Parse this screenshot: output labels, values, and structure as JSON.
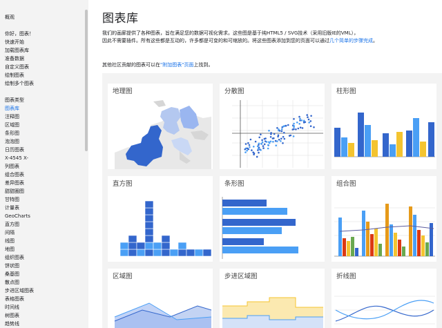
{
  "sidebar": {
    "items": [
      {
        "label": "概观",
        "active": false
      },
      {
        "label": "你好，图表！",
        "active": false
      },
      {
        "label": "快速开始",
        "active": false
      },
      {
        "label": "加载图表库",
        "active": false
      },
      {
        "label": "准备数据",
        "active": false
      },
      {
        "label": "自定义图表",
        "active": false
      },
      {
        "label": "绘制图表",
        "active": false
      },
      {
        "label": "绘制多个图表",
        "active": false
      },
      {
        "label": "图表类型",
        "active": false
      },
      {
        "label": "图表库",
        "active": true
      },
      {
        "label": "注释图",
        "active": false
      },
      {
        "label": "区域图",
        "active": false
      },
      {
        "label": "条形图",
        "active": false
      },
      {
        "label": "泡泡图",
        "active": false
      },
      {
        "label": "日历图表",
        "active": false
      },
      {
        "label": "X-4545 X-",
        "active": false
      },
      {
        "label": "列图表",
        "active": false
      },
      {
        "label": "组合图表",
        "active": false
      },
      {
        "label": "差异图表",
        "active": false
      },
      {
        "label": "甜甜圈图",
        "active": false
      },
      {
        "label": "甘特图",
        "active": false
      },
      {
        "label": "计量表",
        "active": false
      },
      {
        "label": "GeoCharts",
        "active": false
      },
      {
        "label": "直方图",
        "active": false
      },
      {
        "label": "间隔",
        "active": false
      },
      {
        "label": "线图",
        "active": false
      },
      {
        "label": "地图",
        "active": false
      },
      {
        "label": "组织图表",
        "active": false
      },
      {
        "label": "饼状图",
        "active": false
      },
      {
        "label": "桑基图",
        "active": false
      },
      {
        "label": "散点图",
        "active": false
      },
      {
        "label": "步进区域图表",
        "active": false
      },
      {
        "label": "表格图表",
        "active": false
      },
      {
        "label": "时间线",
        "active": false
      },
      {
        "label": "树图表",
        "active": false
      },
      {
        "label": "趋势线",
        "active": false
      }
    ]
  },
  "main": {
    "title": "图表库",
    "para1_line1": "我们的画廊提供了各种图表，旨在满足您的数据可视化需求。这些图是基于纯HTML5 / SVG技术（采用旧版IE的VML），",
    "para1_line2a": "因此不需要插件。所有这些都是互动的，许多都是可变的和可缩放的。将这些图表添加到您的页面可以通过",
    "para1_link": "几个简单的步骤完成",
    "para1_end": "。",
    "para2_before": "其他社区贡献的图表可以在",
    "para2_link": "\"附加图表\"页面",
    "para2_after": "上找到。"
  },
  "cards": [
    {
      "title": "地理图"
    },
    {
      "title": "分散图"
    },
    {
      "title": "柱形图"
    },
    {
      "title": "直方图"
    },
    {
      "title": "条形图"
    },
    {
      "title": "组合图"
    },
    {
      "title": "区域图"
    },
    {
      "title": "步进区域图"
    },
    {
      "title": "折线图"
    }
  ],
  "colors": {
    "blue": "#3366cc",
    "light_blue": "#4a9ff5",
    "yellow": "#f4c430",
    "orange": "#e69a1a",
    "red": "#dc3912",
    "green": "#6aa84f",
    "link": "#1a73e8"
  }
}
